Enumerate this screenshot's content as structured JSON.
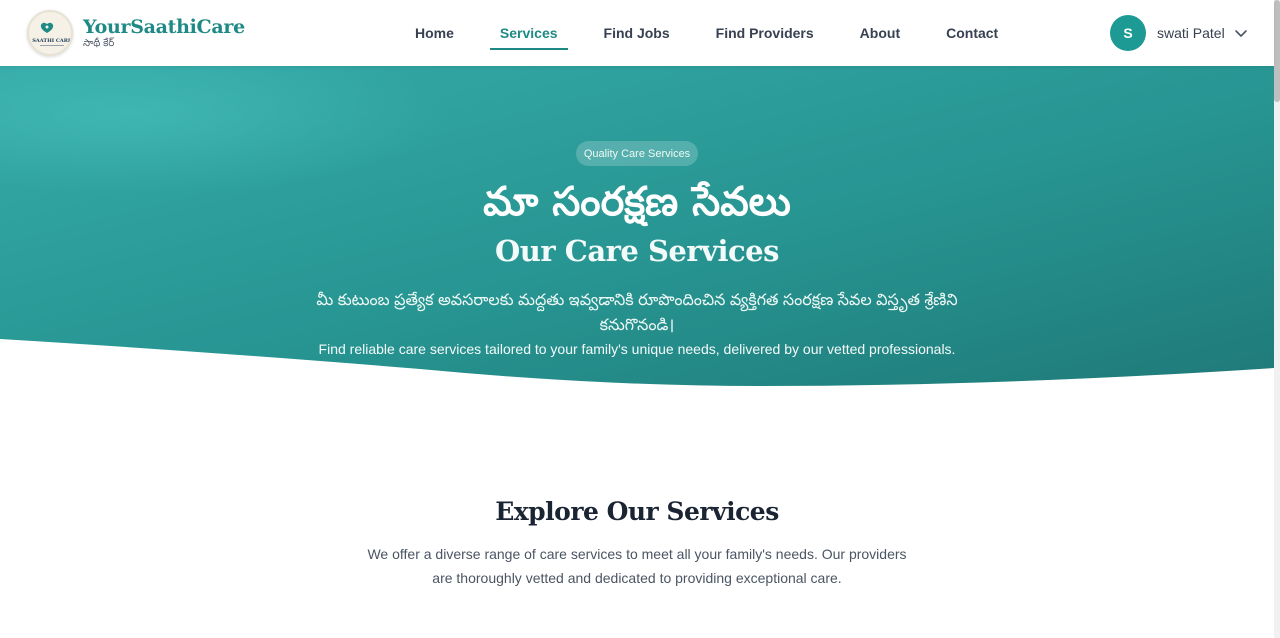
{
  "brand": {
    "name": "YourSaathiCare",
    "tagline": "సాథీ కేర్",
    "logo_text": "SAATHI CARE"
  },
  "nav": {
    "items": [
      {
        "label": "Home",
        "active": false
      },
      {
        "label": "Services",
        "active": true
      },
      {
        "label": "Find Jobs",
        "active": false
      },
      {
        "label": "Find Providers",
        "active": false
      },
      {
        "label": "About",
        "active": false
      },
      {
        "label": "Contact",
        "active": false
      }
    ]
  },
  "user": {
    "initial": "S",
    "name": "swati Patel"
  },
  "hero": {
    "badge": "Quality Care Services",
    "title_telugu": "మా సంరక్షణ సేవలు",
    "title": "Our Care Services",
    "description_telugu": "మీ కుటుంబ ప్రత్యేక అవసరాలకు మద్దతు ఇవ్వడానికి రూపొందించిన వ్యక్తిగత సంరక్షణ సేవల విస్తృత శ్రేణిని కనుగొనండి।",
    "description": "Find reliable care services tailored to your family's unique needs, delivered by our vetted professionals."
  },
  "explore": {
    "title": "Explore Our Services",
    "description": "We offer a diverse range of care services to meet all your family's needs. Our providers are thoroughly vetted and dedicated to providing exceptional care."
  },
  "colors": {
    "brand_teal": "#1f8a85",
    "hero_start": "#35aaa8",
    "hero_end": "#1f7a78",
    "avatar": "#1c9a93"
  },
  "icons": {
    "logo": "heart-logo-icon",
    "user_menu": "chevron-down-icon"
  }
}
